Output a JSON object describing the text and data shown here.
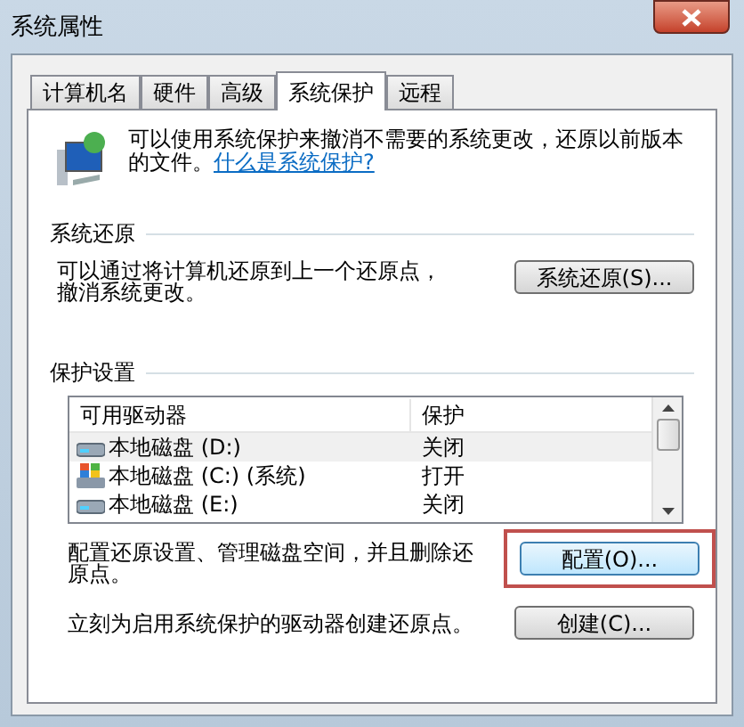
{
  "window": {
    "title": "系统属性"
  },
  "tabs": [
    {
      "label": "计算机名",
      "selected": false
    },
    {
      "label": "硬件",
      "selected": false
    },
    {
      "label": "高级",
      "selected": false
    },
    {
      "label": "系统保护",
      "selected": true
    },
    {
      "label": "远程",
      "selected": false
    }
  ],
  "intro": {
    "text": "可以使用系统保护来撤消不需要的系统更改，还原以前版本的文件。",
    "link": "什么是系统保护?"
  },
  "system_restore": {
    "heading": "系统还原",
    "text": "可以通过将计算机还原到上一个还原点，撤消系统更改。",
    "button": "系统还原(S)..."
  },
  "protection": {
    "heading": "保护设置",
    "columns": [
      "可用驱动器",
      "保护"
    ],
    "rows": [
      {
        "drive": "本地磁盘 (D:)",
        "kind": "disk",
        "protection": "关闭",
        "selected": true
      },
      {
        "drive": "本地磁盘 (C:) (系统)",
        "kind": "system",
        "protection": "打开",
        "selected": false
      },
      {
        "drive": "本地磁盘 (E:)",
        "kind": "disk",
        "protection": "关闭",
        "selected": false
      }
    ],
    "configure_text": "配置还原设置、管理磁盘空间，并且删除还原点。",
    "configure_button": "配置(O)...",
    "configure_highlighted": true,
    "create_text": "立刻为启用系统保护的驱动器创建还原点。",
    "create_button": "创建(C)..."
  }
}
